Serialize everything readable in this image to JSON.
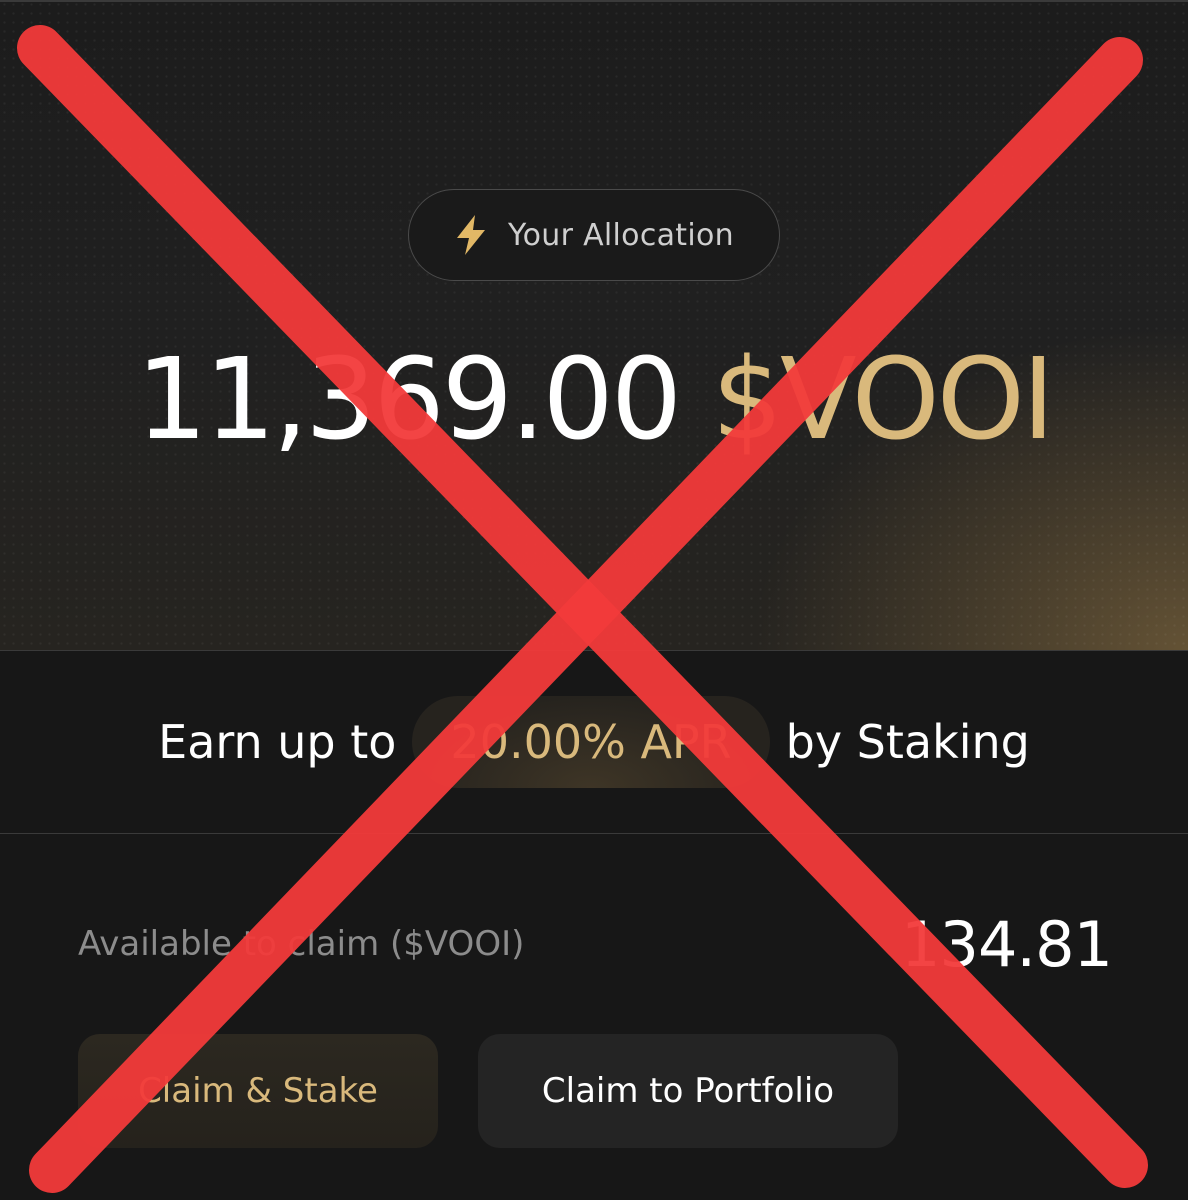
{
  "allocation": {
    "label": "Your Allocation",
    "icon": "lightning-bolt-icon",
    "amount": "11,369.00",
    "token": "$VOOI"
  },
  "staking": {
    "prefix": "Earn up to",
    "apr": "20.00% APR",
    "suffix": "by Staking"
  },
  "claim": {
    "available_label": "Available to claim ($VOOI)",
    "available_value": "134.81",
    "claim_stake_label": "Claim & Stake",
    "claim_portfolio_label": "Claim to Portfolio"
  },
  "colors": {
    "accent_gold": "#d9b97c",
    "background": "#171717",
    "cross_red": "#f23a3a"
  }
}
